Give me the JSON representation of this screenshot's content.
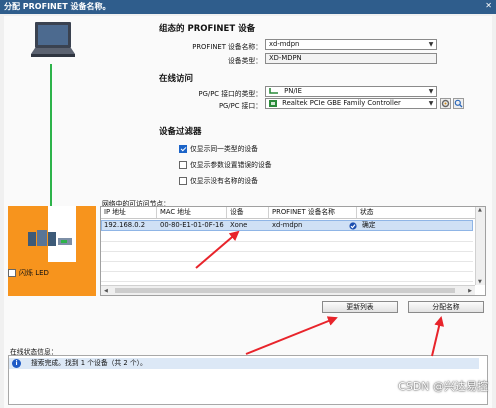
{
  "window": {
    "title": "分配 PROFINET 设备名称。",
    "close_glyph": "✕"
  },
  "configured_device": {
    "heading": "组态的 PROFINET 设备",
    "name_label": "PROFINET 设备名称：",
    "name_value": "xd-mdpn",
    "type_label": "设备类型：",
    "type_value": "XD-MDPN"
  },
  "online_access": {
    "heading": "在线访问",
    "pgpc_type_label": "PG/PC 接口的类型：",
    "pgpc_type_value": "PN/IE",
    "pgpc_iface_label": "PG/PC 接口：",
    "pgpc_iface_value": "Realtek PCIe GBE Family Controller"
  },
  "device_filter": {
    "heading": "设备过滤器",
    "options": [
      {
        "label": "仅显示同一类型的设备",
        "checked": true
      },
      {
        "label": "仅显示参数设置错误的设备",
        "checked": false
      },
      {
        "label": "仅显示没有名称的设备",
        "checked": false
      }
    ]
  },
  "device_panel": {
    "flash_led_label": "闪烁 LED",
    "color": "#f7941d"
  },
  "nodes_table": {
    "caption": "网络中的可访问节点：",
    "columns": [
      "IP 地址",
      "MAC 地址",
      "设备",
      "PROFINET 设备名称",
      "状态"
    ],
    "rows": [
      {
        "ip": "192.168.0.2",
        "mac": "00-80-E1-01-0F-16",
        "device": "Xone",
        "name": "xd-mdpn",
        "status": "确定"
      }
    ]
  },
  "buttons": {
    "update_list": "更新列表",
    "assign_name": "分配名称"
  },
  "status": {
    "label": "在线状态信息：",
    "messages": [
      {
        "icon": "info-icon",
        "text": "搜索完成。找到 1 个设备（共 2 个）。"
      }
    ]
  },
  "watermark": "CSDN @兴达易控",
  "colors": {
    "title_bar": "#2f5d8c",
    "link_line": "#2db34a",
    "annotation_arrow": "#e8242b",
    "selection": "#cfe0f5"
  }
}
